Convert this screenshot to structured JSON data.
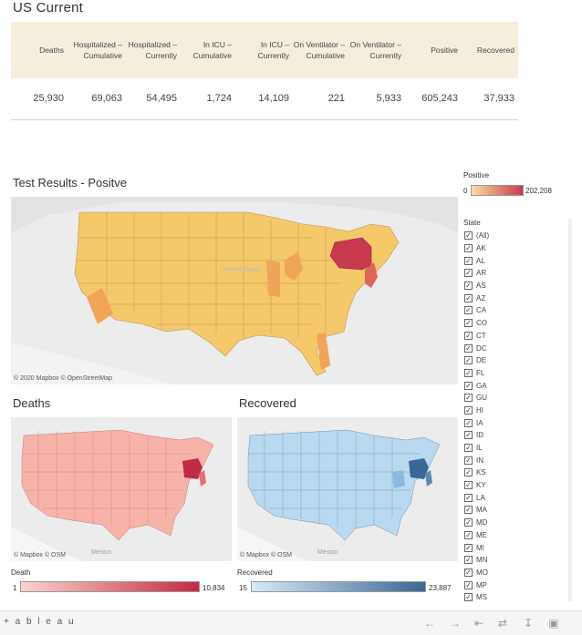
{
  "summary": {
    "title": "US Current",
    "columns": [
      {
        "label": "Deaths",
        "value": "25,930"
      },
      {
        "label": "Hospitalized – Cumulative",
        "value": "69,063"
      },
      {
        "label": "Hospitalized – Currently",
        "value": "54,495"
      },
      {
        "label": "In ICU – Cumulative",
        "value": "1,724"
      },
      {
        "label": "In ICU – Currently",
        "value": "14,109"
      },
      {
        "label": "On Ventilator – Cumulative",
        "value": "221"
      },
      {
        "label": "On Ventilator – Currently",
        "value": "5,933"
      },
      {
        "label": "Positive",
        "value": "605,243"
      },
      {
        "label": "Recovered",
        "value": "37,933"
      }
    ]
  },
  "positive_map": {
    "title": "Test Results - Positve",
    "attribution": "© 2020 Mapbox © OpenStreetMap",
    "country_label": "United States",
    "colors": {
      "base": "#f5c86a",
      "high": "#c8384f"
    }
  },
  "deaths_map": {
    "title": "Deaths",
    "attribution": "© Mapbox © OSM",
    "mexico_label": "Mexico",
    "colors": {
      "base": "#f7b3aa",
      "high": "#c22a43"
    }
  },
  "recovered_map": {
    "title": "Recovered",
    "attribution": "© Mapbox © OSM",
    "mexico_label": "Mexico",
    "colors": {
      "base": "#b8d9ef",
      "high": "#3a6796"
    }
  },
  "legends": {
    "positive": {
      "title": "Positive",
      "min": "0",
      "max": "202,208",
      "from": "#f8dfa0",
      "to": "#c8384f"
    },
    "death": {
      "title": "Death",
      "min": "1",
      "max": "10,834",
      "from": "#fbd3cf",
      "to": "#c22a43"
    },
    "recovered": {
      "title": "Recovered",
      "min": "15",
      "max": "23,887",
      "from": "#d6eaf7",
      "to": "#3a6796"
    }
  },
  "state_filter": {
    "title": "State",
    "items": [
      "(All)",
      "AK",
      "AL",
      "AR",
      "AS",
      "AZ",
      "CA",
      "CO",
      "CT",
      "DC",
      "DE",
      "FL",
      "GA",
      "GU",
      "HI",
      "IA",
      "ID",
      "IL",
      "IN",
      "KS",
      "KY",
      "LA",
      "MA",
      "MD",
      "ME",
      "MI",
      "MN",
      "MO",
      "MP",
      "MS"
    ]
  },
  "footer": {
    "logo": "+ a b l e a u",
    "icons": [
      "undo-icon",
      "redo-icon",
      "revert-icon",
      "share-icon",
      "download-icon",
      "fullscreen-icon"
    ]
  }
}
